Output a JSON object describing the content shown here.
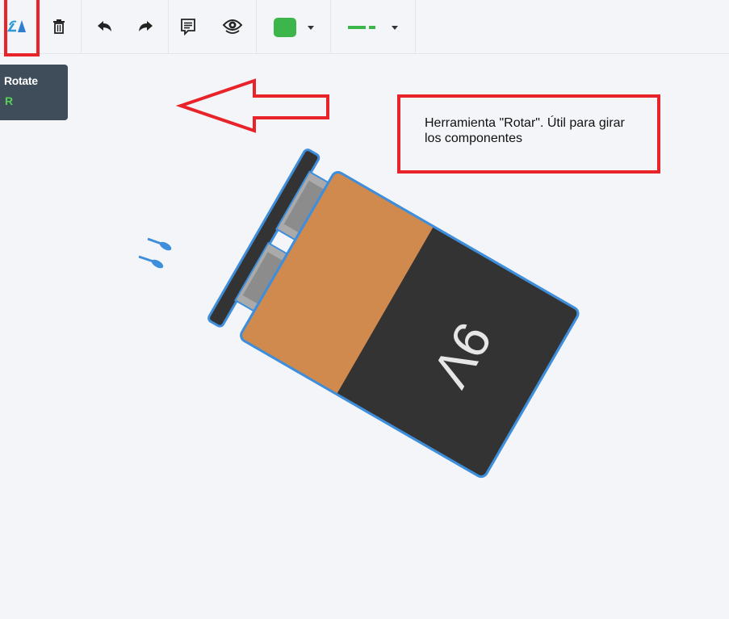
{
  "toolbar": {
    "buttons": [
      {
        "name": "rotate",
        "icon": "rotate-icon"
      },
      {
        "name": "delete",
        "icon": "trash-icon"
      },
      {
        "name": "undo",
        "icon": "undo-icon"
      },
      {
        "name": "redo",
        "icon": "redo-icon"
      },
      {
        "name": "notes",
        "icon": "notes-icon"
      },
      {
        "name": "view",
        "icon": "eye-icon"
      }
    ],
    "fill_color": "#3cb54a",
    "line_color": "#3cb54a"
  },
  "tooltip": {
    "title": "Rotate",
    "shortcut": "R"
  },
  "annotation": {
    "text": "Herramienta \"Rotar\". Útil para girar los componentes",
    "color": "#e8232a"
  },
  "component": {
    "label": "9V",
    "body_color": "#333333",
    "band_color": "#d08a4e",
    "outline_color": "#3e8edc"
  }
}
